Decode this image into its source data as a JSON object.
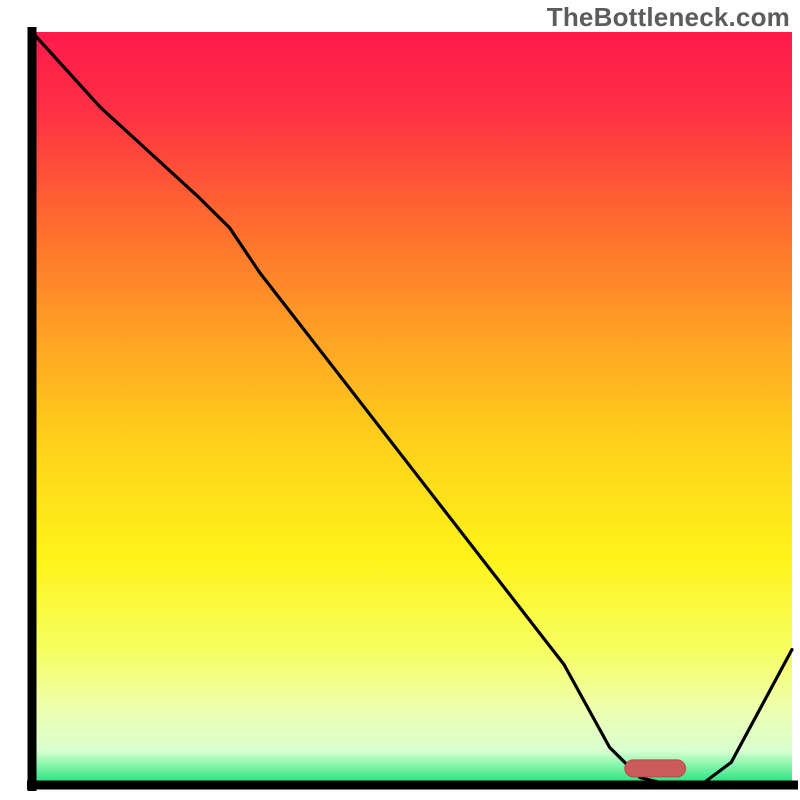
{
  "watermark": "TheBottleneck.com",
  "chart_data": {
    "type": "line",
    "title": "",
    "xlabel": "",
    "ylabel": "",
    "xlim": [
      0,
      100
    ],
    "ylim": [
      0,
      100
    ],
    "x": [
      0,
      9,
      22,
      26,
      30,
      40,
      50,
      60,
      70,
      76,
      80,
      84,
      88,
      92,
      100
    ],
    "values": [
      100,
      90,
      78,
      74,
      68,
      55,
      42,
      29,
      16,
      5,
      1,
      0,
      0,
      3,
      18
    ],
    "marker": {
      "x_start": 78,
      "x_end": 86,
      "y": 2.2
    },
    "gradient_stops": [
      {
        "offset": 0.0,
        "color": "#ff1a4b"
      },
      {
        "offset": 0.1,
        "color": "#ff2e45"
      },
      {
        "offset": 0.25,
        "color": "#ff6a2f"
      },
      {
        "offset": 0.4,
        "color": "#ffa024"
      },
      {
        "offset": 0.55,
        "color": "#ffd21a"
      },
      {
        "offset": 0.7,
        "color": "#fff31a"
      },
      {
        "offset": 0.82,
        "color": "#f6ff60"
      },
      {
        "offset": 0.9,
        "color": "#eeffb0"
      },
      {
        "offset": 0.955,
        "color": "#d8ffd0"
      },
      {
        "offset": 0.975,
        "color": "#7ff5a8"
      },
      {
        "offset": 1.0,
        "color": "#19e07a"
      }
    ],
    "colors": {
      "axis": "#000000",
      "curve": "#000000",
      "marker_fill": "#cc5a5a",
      "marker_stroke": "#b24a4a",
      "background": "#ffffff"
    }
  }
}
